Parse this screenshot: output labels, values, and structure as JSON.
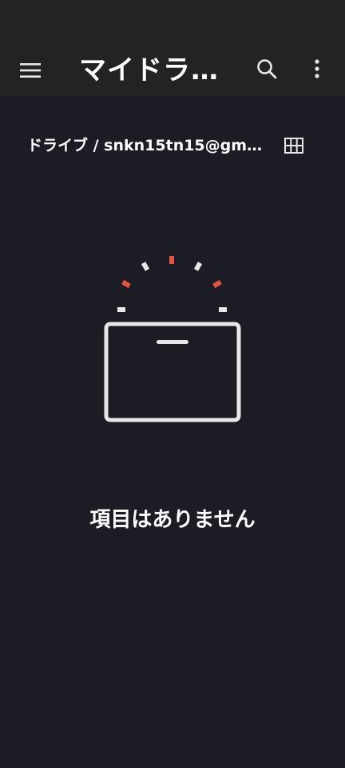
{
  "app_bar": {
    "title": "マイドラ...",
    "menu_icon": "hamburger-menu-icon",
    "search_icon": "search-icon",
    "more_icon": "more-vert-icon"
  },
  "breadcrumb": {
    "text": "ドライブ / snkn15tn15@gmail..."
  },
  "view_toggle": {
    "icon": "grid-view-icon"
  },
  "empty_state": {
    "message": "項目はありません",
    "illustration": "empty-box-icon"
  },
  "colors": {
    "background": "#1b1c24",
    "app_bar": "#222325",
    "icon": "#e8e8e8",
    "accent": "#e25543"
  }
}
